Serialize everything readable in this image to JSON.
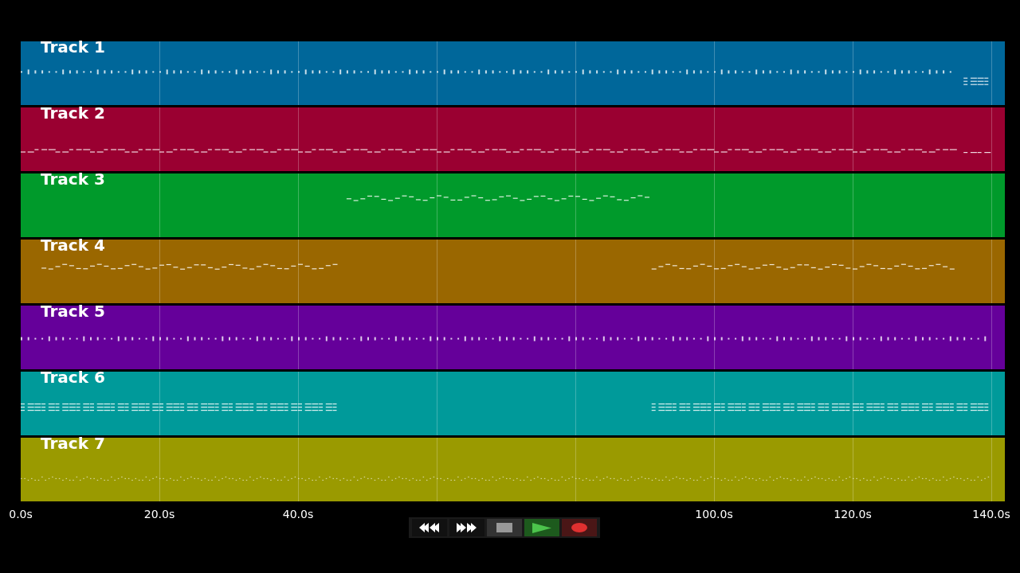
{
  "tracks": [
    {
      "label": "Track 1",
      "color": "#00679a"
    },
    {
      "label": "Track 2",
      "color": "#9a0031"
    },
    {
      "label": "Track 3",
      "color": "#009a2b"
    },
    {
      "label": "Track 4",
      "color": "#9a6700"
    },
    {
      "label": "Track 5",
      "color": "#65009a"
    },
    {
      "label": "Track 6",
      "color": "#009a9a"
    },
    {
      "label": "Track 7",
      "color": "#9a9a00"
    }
  ],
  "axis": {
    "ticks": [
      "0.0s",
      "20.0s",
      "40.0s",
      "100.0s",
      "120.0s",
      "140.0s"
    ]
  },
  "transport": {
    "buttons": [
      {
        "kind": "rewind"
      },
      {
        "kind": "forward"
      },
      {
        "kind": "stop"
      },
      {
        "kind": "play"
      },
      {
        "kind": "record"
      }
    ]
  }
}
